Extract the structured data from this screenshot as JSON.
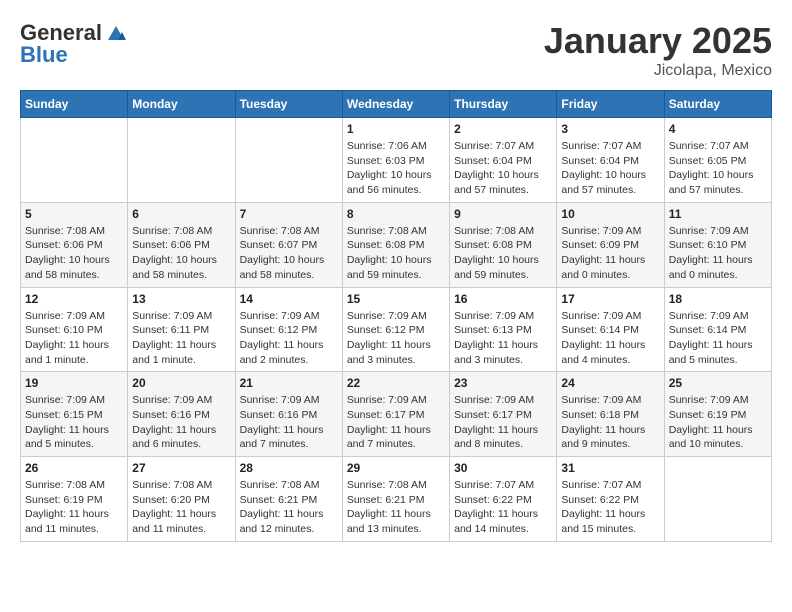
{
  "header": {
    "logo_line1": "General",
    "logo_line2": "Blue",
    "month": "January 2025",
    "location": "Jicolapa, Mexico"
  },
  "days_of_week": [
    "Sunday",
    "Monday",
    "Tuesday",
    "Wednesday",
    "Thursday",
    "Friday",
    "Saturday"
  ],
  "weeks": [
    [
      {
        "day": "",
        "info": ""
      },
      {
        "day": "",
        "info": ""
      },
      {
        "day": "",
        "info": ""
      },
      {
        "day": "1",
        "info": "Sunrise: 7:06 AM\nSunset: 6:03 PM\nDaylight: 10 hours\nand 56 minutes."
      },
      {
        "day": "2",
        "info": "Sunrise: 7:07 AM\nSunset: 6:04 PM\nDaylight: 10 hours\nand 57 minutes."
      },
      {
        "day": "3",
        "info": "Sunrise: 7:07 AM\nSunset: 6:04 PM\nDaylight: 10 hours\nand 57 minutes."
      },
      {
        "day": "4",
        "info": "Sunrise: 7:07 AM\nSunset: 6:05 PM\nDaylight: 10 hours\nand 57 minutes."
      }
    ],
    [
      {
        "day": "5",
        "info": "Sunrise: 7:08 AM\nSunset: 6:06 PM\nDaylight: 10 hours\nand 58 minutes."
      },
      {
        "day": "6",
        "info": "Sunrise: 7:08 AM\nSunset: 6:06 PM\nDaylight: 10 hours\nand 58 minutes."
      },
      {
        "day": "7",
        "info": "Sunrise: 7:08 AM\nSunset: 6:07 PM\nDaylight: 10 hours\nand 58 minutes."
      },
      {
        "day": "8",
        "info": "Sunrise: 7:08 AM\nSunset: 6:08 PM\nDaylight: 10 hours\nand 59 minutes."
      },
      {
        "day": "9",
        "info": "Sunrise: 7:08 AM\nSunset: 6:08 PM\nDaylight: 10 hours\nand 59 minutes."
      },
      {
        "day": "10",
        "info": "Sunrise: 7:09 AM\nSunset: 6:09 PM\nDaylight: 11 hours\nand 0 minutes."
      },
      {
        "day": "11",
        "info": "Sunrise: 7:09 AM\nSunset: 6:10 PM\nDaylight: 11 hours\nand 0 minutes."
      }
    ],
    [
      {
        "day": "12",
        "info": "Sunrise: 7:09 AM\nSunset: 6:10 PM\nDaylight: 11 hours\nand 1 minute."
      },
      {
        "day": "13",
        "info": "Sunrise: 7:09 AM\nSunset: 6:11 PM\nDaylight: 11 hours\nand 1 minute."
      },
      {
        "day": "14",
        "info": "Sunrise: 7:09 AM\nSunset: 6:12 PM\nDaylight: 11 hours\nand 2 minutes."
      },
      {
        "day": "15",
        "info": "Sunrise: 7:09 AM\nSunset: 6:12 PM\nDaylight: 11 hours\nand 3 minutes."
      },
      {
        "day": "16",
        "info": "Sunrise: 7:09 AM\nSunset: 6:13 PM\nDaylight: 11 hours\nand 3 minutes."
      },
      {
        "day": "17",
        "info": "Sunrise: 7:09 AM\nSunset: 6:14 PM\nDaylight: 11 hours\nand 4 minutes."
      },
      {
        "day": "18",
        "info": "Sunrise: 7:09 AM\nSunset: 6:14 PM\nDaylight: 11 hours\nand 5 minutes."
      }
    ],
    [
      {
        "day": "19",
        "info": "Sunrise: 7:09 AM\nSunset: 6:15 PM\nDaylight: 11 hours\nand 5 minutes."
      },
      {
        "day": "20",
        "info": "Sunrise: 7:09 AM\nSunset: 6:16 PM\nDaylight: 11 hours\nand 6 minutes."
      },
      {
        "day": "21",
        "info": "Sunrise: 7:09 AM\nSunset: 6:16 PM\nDaylight: 11 hours\nand 7 minutes."
      },
      {
        "day": "22",
        "info": "Sunrise: 7:09 AM\nSunset: 6:17 PM\nDaylight: 11 hours\nand 7 minutes."
      },
      {
        "day": "23",
        "info": "Sunrise: 7:09 AM\nSunset: 6:17 PM\nDaylight: 11 hours\nand 8 minutes."
      },
      {
        "day": "24",
        "info": "Sunrise: 7:09 AM\nSunset: 6:18 PM\nDaylight: 11 hours\nand 9 minutes."
      },
      {
        "day": "25",
        "info": "Sunrise: 7:09 AM\nSunset: 6:19 PM\nDaylight: 11 hours\nand 10 minutes."
      }
    ],
    [
      {
        "day": "26",
        "info": "Sunrise: 7:08 AM\nSunset: 6:19 PM\nDaylight: 11 hours\nand 11 minutes."
      },
      {
        "day": "27",
        "info": "Sunrise: 7:08 AM\nSunset: 6:20 PM\nDaylight: 11 hours\nand 11 minutes."
      },
      {
        "day": "28",
        "info": "Sunrise: 7:08 AM\nSunset: 6:21 PM\nDaylight: 11 hours\nand 12 minutes."
      },
      {
        "day": "29",
        "info": "Sunrise: 7:08 AM\nSunset: 6:21 PM\nDaylight: 11 hours\nand 13 minutes."
      },
      {
        "day": "30",
        "info": "Sunrise: 7:07 AM\nSunset: 6:22 PM\nDaylight: 11 hours\nand 14 minutes."
      },
      {
        "day": "31",
        "info": "Sunrise: 7:07 AM\nSunset: 6:22 PM\nDaylight: 11 hours\nand 15 minutes."
      },
      {
        "day": "",
        "info": ""
      }
    ]
  ]
}
